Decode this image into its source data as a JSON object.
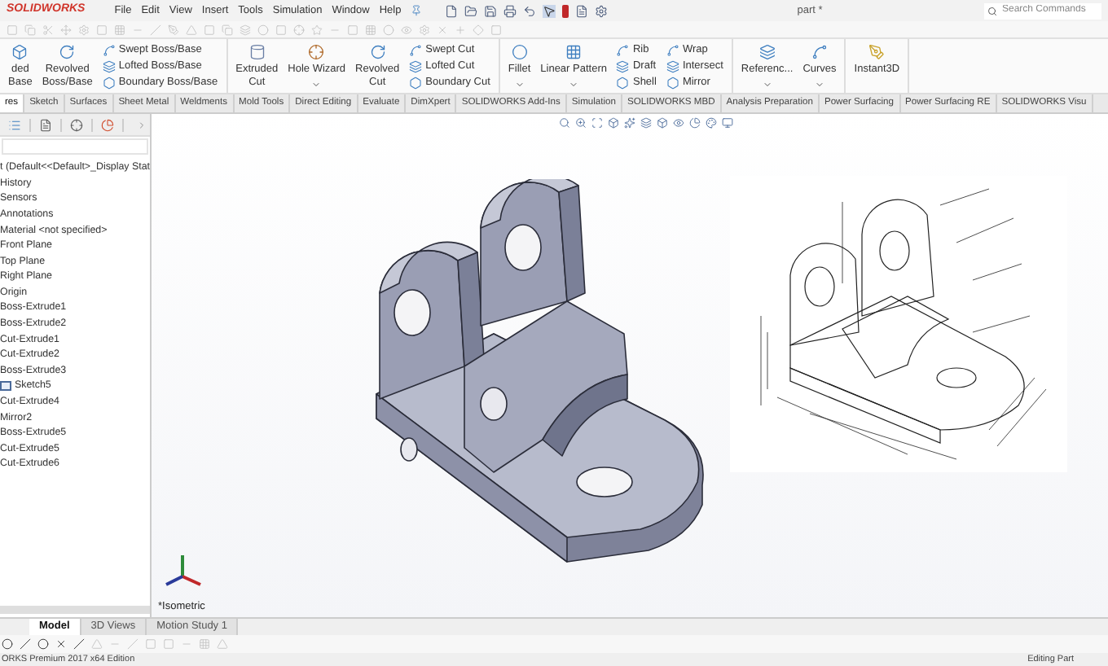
{
  "app": {
    "logo": "SOLIDWORKS",
    "menus": [
      "File",
      "Edit",
      "View",
      "Insert",
      "Tools",
      "Simulation",
      "Window",
      "Help"
    ],
    "document_title": "part *",
    "search": {
      "placeholder": "Search Commands"
    }
  },
  "ribbon": {
    "groups": [
      {
        "columns": [
          {
            "kind": "large",
            "lines": [
              "ded",
              "Base"
            ],
            "menu": false
          },
          {
            "kind": "large",
            "lines": [
              "Revolved",
              "Boss/Base"
            ],
            "menu": false
          },
          {
            "kind": "stack",
            "lines": [
              "Swept Boss/Base",
              "Lofted Boss/Base",
              "Boundary Boss/Base"
            ]
          }
        ]
      },
      {
        "columns": [
          {
            "kind": "large",
            "lines": [
              "Extruded",
              "Cut"
            ],
            "menu": false
          },
          {
            "kind": "large",
            "lines": [
              "Hole Wizard"
            ],
            "menu": true
          },
          {
            "kind": "large",
            "lines": [
              "Revolved",
              "Cut"
            ],
            "menu": false
          },
          {
            "kind": "stack",
            "lines": [
              "Swept Cut",
              "Lofted Cut",
              "Boundary Cut"
            ]
          }
        ]
      },
      {
        "columns": [
          {
            "kind": "large",
            "lines": [
              "Fillet"
            ],
            "menu": true
          },
          {
            "kind": "large",
            "lines": [
              "Linear Pattern"
            ],
            "menu": true
          },
          {
            "kind": "stack",
            "lines": [
              "Rib",
              "Draft",
              "Shell"
            ]
          },
          {
            "kind": "stack",
            "lines": [
              "Wrap",
              "Intersect",
              "Mirror"
            ]
          }
        ]
      },
      {
        "columns": [
          {
            "kind": "large",
            "lines": [
              "Referenc..."
            ],
            "menu": true
          },
          {
            "kind": "large",
            "lines": [
              "Curves"
            ],
            "menu": true
          }
        ]
      },
      {
        "columns": [
          {
            "kind": "large",
            "lines": [
              "Instant3D"
            ],
            "menu": false
          }
        ]
      }
    ]
  },
  "tabs": [
    {
      "label": "res",
      "selected": true
    },
    {
      "label": "Sketch",
      "selected": false
    },
    {
      "label": "Surfaces",
      "selected": false
    },
    {
      "label": "Sheet Metal",
      "selected": false
    },
    {
      "label": "Weldments",
      "selected": false
    },
    {
      "label": "Mold Tools",
      "selected": false
    },
    {
      "label": "Direct Editing",
      "selected": false
    },
    {
      "label": "Evaluate",
      "selected": false
    },
    {
      "label": "DimXpert",
      "selected": false
    },
    {
      "label": "SOLIDWORKS Add-Ins",
      "selected": false
    },
    {
      "label": "Simulation",
      "selected": false
    },
    {
      "label": "SOLIDWORKS MBD",
      "selected": false
    },
    {
      "label": "Analysis Preparation",
      "selected": false
    },
    {
      "label": "Power Surfacing",
      "selected": false
    },
    {
      "label": "Power Surfacing RE",
      "selected": false
    },
    {
      "label": "SOLIDWORKS Visu",
      "selected": false
    }
  ],
  "feature_tree": {
    "items": [
      {
        "kind": "feature",
        "label": "t  (Default<<Default>_Display Stat"
      },
      {
        "kind": "feature",
        "label": "History"
      },
      {
        "kind": "feature",
        "label": "Sensors"
      },
      {
        "kind": "feature",
        "label": "Annotations"
      },
      {
        "kind": "feature",
        "label": "Material <not specified>"
      },
      {
        "kind": "feature",
        "label": "Front Plane"
      },
      {
        "kind": "feature",
        "label": "Top Plane"
      },
      {
        "kind": "feature",
        "label": "Right Plane"
      },
      {
        "kind": "feature",
        "label": "Origin"
      },
      {
        "kind": "feature",
        "label": "Boss-Extrude1"
      },
      {
        "kind": "feature",
        "label": "Boss-Extrude2"
      },
      {
        "kind": "feature",
        "label": "Cut-Extrude1"
      },
      {
        "kind": "feature",
        "label": "Cut-Extrude2"
      },
      {
        "kind": "feature",
        "label": "Boss-Extrude3"
      },
      {
        "kind": "sketch",
        "label": "Sketch5"
      },
      {
        "kind": "feature",
        "label": "Cut-Extrude4"
      },
      {
        "kind": "feature",
        "label": "Mirror2"
      },
      {
        "kind": "feature",
        "label": "Boss-Extrude5"
      },
      {
        "kind": "feature",
        "label": "Cut-Extrude5"
      },
      {
        "kind": "feature",
        "label": "Cut-Extrude6"
      }
    ]
  },
  "viewport": {
    "view_label": "*Isometric"
  },
  "bottom_tabs": [
    {
      "label": "Model",
      "selected": true
    },
    {
      "label": "3D Views",
      "selected": false
    },
    {
      "label": "Motion Study 1",
      "selected": false
    }
  ],
  "status_bar": {
    "left": "ORKS Premium 2017 x64 Edition",
    "right": "Editing Part"
  }
}
